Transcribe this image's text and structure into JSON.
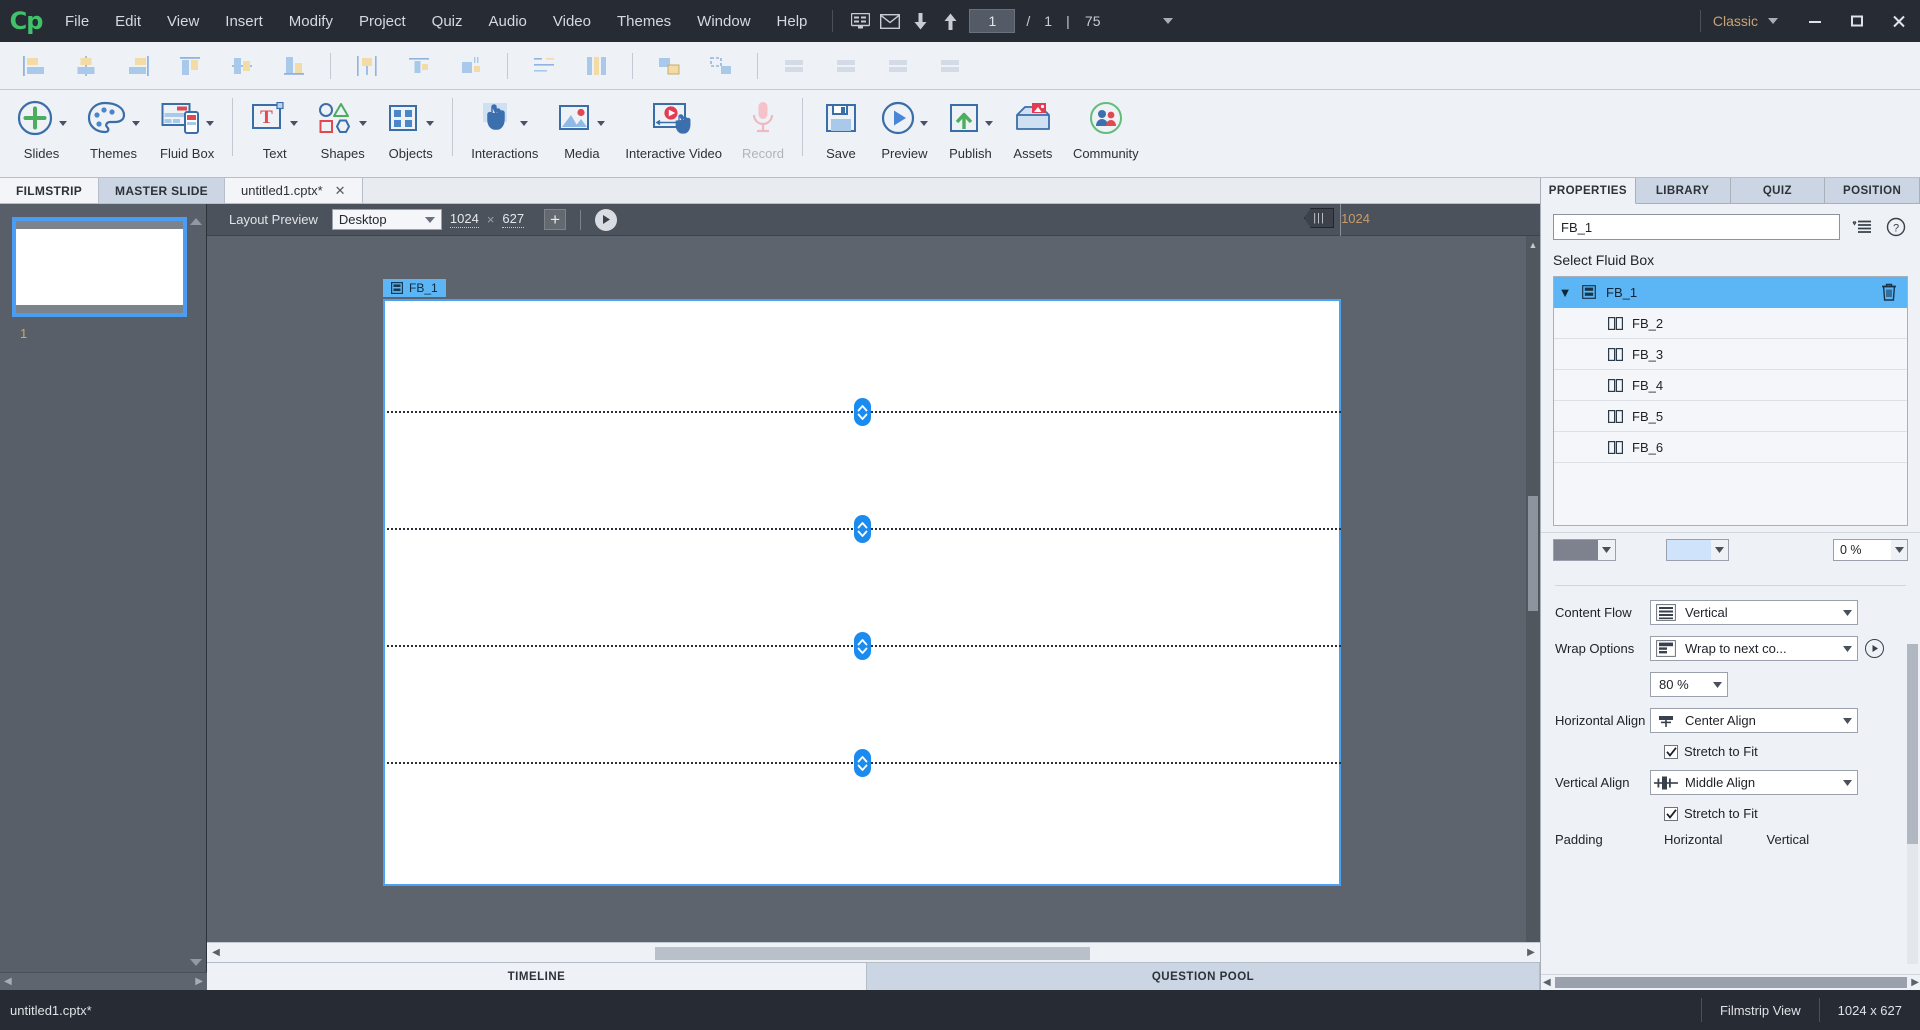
{
  "app": {
    "logo": "Cp",
    "workspace": "Classic",
    "window_controls": {
      "minimize": "—",
      "maximize": "❐",
      "close": "✕"
    }
  },
  "menubar": {
    "items": [
      "File",
      "Edit",
      "View",
      "Insert",
      "Modify",
      "Project",
      "Quiz",
      "Audio",
      "Video",
      "Themes",
      "Window",
      "Help"
    ],
    "slide_current": "1",
    "slide_separator": "/",
    "slide_total": "1",
    "divider": "|",
    "zoom": "75"
  },
  "ribbon": {
    "items": [
      {
        "label": "Slides",
        "icon": "add-slide-icon",
        "caret": true,
        "disabled": false
      },
      {
        "label": "Themes",
        "icon": "palette-icon",
        "caret": true,
        "disabled": false
      },
      {
        "label": "Fluid Box",
        "icon": "fluid-box-icon",
        "caret": true,
        "disabled": false
      },
      {
        "label": "Text",
        "icon": "text-icon",
        "caret": true,
        "disabled": false
      },
      {
        "label": "Shapes",
        "icon": "shapes-icon",
        "caret": true,
        "disabled": false
      },
      {
        "label": "Objects",
        "icon": "objects-icon",
        "caret": true,
        "disabled": false
      },
      {
        "label": "Interactions",
        "icon": "interactions-icon",
        "caret": true,
        "disabled": false
      },
      {
        "label": "Media",
        "icon": "media-icon",
        "caret": true,
        "disabled": false
      },
      {
        "label": "Interactive Video",
        "icon": "interactive-video-icon",
        "caret": false,
        "disabled": false
      },
      {
        "label": "Record",
        "icon": "microphone-icon",
        "caret": false,
        "disabled": true
      },
      {
        "label": "Save",
        "icon": "save-icon",
        "caret": false,
        "disabled": false
      },
      {
        "label": "Preview",
        "icon": "preview-play-icon",
        "caret": true,
        "disabled": false
      },
      {
        "label": "Publish",
        "icon": "publish-upload-icon",
        "caret": true,
        "disabled": false
      },
      {
        "label": "Assets",
        "icon": "assets-box-icon",
        "caret": false,
        "disabled": false
      },
      {
        "label": "Community",
        "icon": "community-people-icon",
        "caret": false,
        "disabled": false
      }
    ]
  },
  "doctabs": {
    "tabs": [
      {
        "label": "FILMSTRIP",
        "shaded": false,
        "closable": false
      },
      {
        "label": "MASTER SLIDE",
        "shaded": true,
        "closable": false
      },
      {
        "label": "untitled1.cptx*",
        "shaded": false,
        "closable": true,
        "close": "✕"
      }
    ]
  },
  "filmstrip": {
    "slide_number": "1"
  },
  "canvas": {
    "layout_preview_label": "Layout Preview",
    "device": "Desktop",
    "width": "1024",
    "times": "×",
    "height": "627",
    "add_button": "+",
    "divider": "|",
    "ruler_value": "1024",
    "fluid_box_tag": "FB_1"
  },
  "bottom_tabs": {
    "timeline": "TIMELINE",
    "question_pool": "QUESTION POOL"
  },
  "properties": {
    "tabs": [
      {
        "label": "PROPERTIES",
        "active": true
      },
      {
        "label": "LIBRARY",
        "active": false
      },
      {
        "label": "QUIZ",
        "active": false
      },
      {
        "label": "POSITION",
        "active": false
      }
    ],
    "name_value": "FB_1",
    "section_title": "Select Fluid Box",
    "fluid_boxes": [
      {
        "label": "FB_1",
        "selected": true,
        "child": false,
        "expander": "▼"
      },
      {
        "label": "FB_2",
        "selected": false,
        "child": true
      },
      {
        "label": "FB_3",
        "selected": false,
        "child": true
      },
      {
        "label": "FB_4",
        "selected": false,
        "child": true
      },
      {
        "label": "FB_5",
        "selected": false,
        "child": true
      },
      {
        "label": "FB_6",
        "selected": false,
        "child": true
      }
    ],
    "opacity_value": "0 %",
    "fill_color": "#7d828e",
    "stroke_color": "#cfe3fa",
    "content_flow_label": "Content Flow",
    "content_flow_value": "Vertical",
    "wrap_options_label": "Wrap Options",
    "wrap_options_value": "Wrap to next co...",
    "wrap_percent": "80 %",
    "horizontal_align_label": "Horizontal Align",
    "horizontal_align_value": "Center Align",
    "horizontal_stretch_label": "Stretch to Fit",
    "horizontal_stretch_checked": true,
    "vertical_align_label": "Vertical Align",
    "vertical_align_value": "Middle Align",
    "vertical_stretch_label": "Stretch to Fit",
    "vertical_stretch_checked": true,
    "padding_label": "Padding",
    "padding_horizontal": "Horizontal",
    "padding_vertical": "Vertical"
  },
  "statusbar": {
    "filename": "untitled1.cptx*",
    "view_mode": "Filmstrip View",
    "dimensions": "1024 x 627"
  }
}
